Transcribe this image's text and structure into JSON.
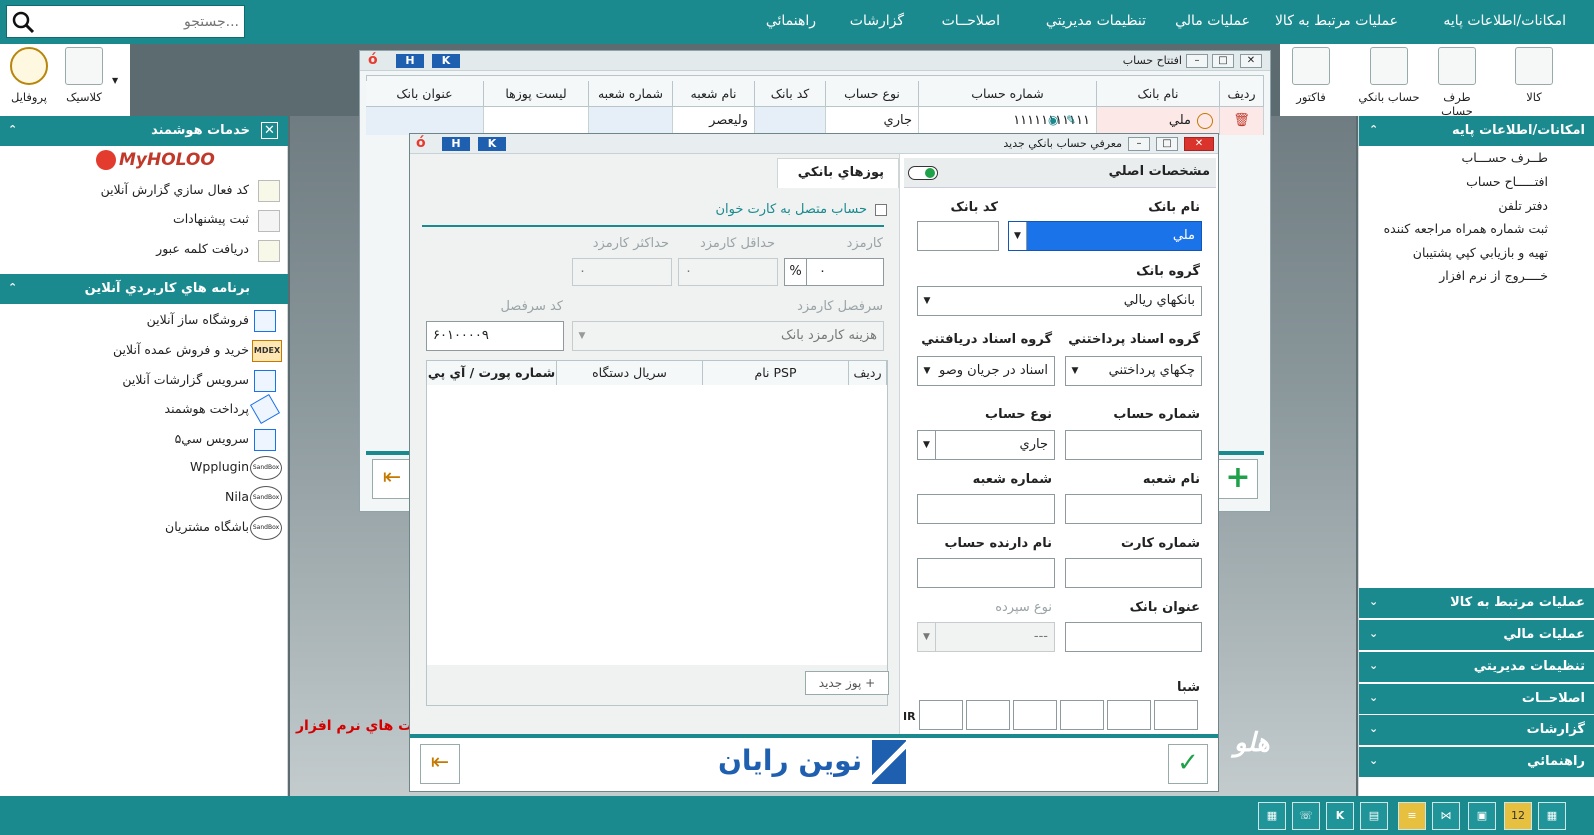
{
  "menubar": {
    "items": [
      "امکانات/اطلاعات پايه",
      "عمليات مرتبط به کالا",
      "عمليات مالي",
      "تنظيمات مديريتي",
      "اصلاحــات",
      "گزارشات",
      "راهنمائي"
    ],
    "search_placeholder": "جستجو..."
  },
  "toolbar_left": {
    "profile": "پروفايل",
    "classic": "کلاسيک"
  },
  "toolbar_right": {
    "items": [
      "کالا",
      "طرف حساب",
      "حساب بانکي",
      "فاکتور"
    ]
  },
  "smart_services": {
    "title": "خدمات هوشمند",
    "logo": "MyHOLOO",
    "items": [
      "کد فعال سازي گزارش آنلاين",
      "ثبت پيشنهادات",
      "دريافت کلمه عبور"
    ]
  },
  "online_apps": {
    "title": "برنامه هاي کاربردي آنلاين",
    "items": [
      "فروشگاه ساز آنلاين",
      "خريد و فروش عمده آنلاين",
      "سرويس گزارشات آنلاين",
      "پرداخت هوشمند",
      "سرويس سي۵",
      "Wpplugin",
      "Nila",
      "باشگاه مشتريان"
    ],
    "badge": "SandBox",
    "mdex": "MDEX"
  },
  "right_panel": {
    "title": "امکانات/اطلاعات پايه",
    "items": [
      "طــرف حســـاب",
      "افتـــــاح حساب",
      "دفتر تلفن",
      "ثبت شماره همراه مراجعه کننده",
      "تهيه و بازيابي کپي پشتيبان",
      "خــــروج از نرم افزار"
    ],
    "sections": [
      "عمليات مرتبط به کالا",
      "عمليات مالي",
      "تنظيمات مديريتي",
      "اصلاحــات",
      "گزارشات",
      "راهنمائي"
    ]
  },
  "desktop": {
    "slogan": "ت هاي نرم افزار",
    "logo": "هلو"
  },
  "account_window": {
    "title": "افتتاح حساب",
    "h": "H",
    "k": "K",
    "columns": [
      "رديف",
      "نام بانک",
      "شماره حساب",
      "نوع حساب",
      "کد بانک",
      "نام شعبه",
      "شماره شعبه",
      "ليست پوزها",
      "عنوان بانک"
    ],
    "row": {
      "bank": "ملي",
      "account": "۱۱۱۱۱۱۱۱۱۱۱",
      "type": "جاري",
      "code": "",
      "branch_name": "وليعصر",
      "branch_no": "",
      "pos_list": "",
      "title": ""
    }
  },
  "new_bank_dialog": {
    "title": "معرفي حساب بانکي جديد",
    "tab_main": "مشخصات اصلي",
    "tab_pos": "پوزهاي بانکي",
    "bank_name_label": "نام بانک",
    "bank_name": "ملي",
    "bank_code_label": "کد بانک",
    "bank_group_label": "گروه بانک",
    "bank_group": "بانکهاي ريالي",
    "pay_group_label": "گروه اسناد پرداختني",
    "pay_group": "چکهاي پرداختني",
    "recv_group_label": "گروه اسناد دريافتني",
    "recv_group": "اسناد در جريان وصو",
    "account_no_label": "شماره حساب",
    "account_type_label": "نوع حساب",
    "account_type": "جاري",
    "branch_name_label": "نام شعبه",
    "branch_no_label": "شماره شعبه",
    "card_no_label": "شماره کارت",
    "holder_label": "نام دارنده حساب",
    "bank_title_label": "عنوان بانک",
    "deposit_type_label": "نوع سپرده",
    "deposit_type": "---",
    "sheba_label": "شبا",
    "sheba_prefix": "IR",
    "card_reader_label": "حساب متصل به کارت خوان",
    "fee_label": "کارمزد",
    "fee_value": "۰",
    "percent": "%",
    "min_fee_label": "حداقل کارمزد",
    "min_fee": "۰",
    "max_fee_label": "حداکثر کارمزد",
    "max_fee": "۰",
    "fee_header_label": "سرفصل کارمزد",
    "fee_header": "هزينه کارمزد بانک",
    "header_code_label": "کد سرفصل",
    "header_code": "۶۰۱۰۰۰۰۹",
    "pos_columns": [
      "رديف",
      "نام PSP",
      "سريال دستگاه",
      "شماره پورت / آي پي"
    ],
    "new_pos": "پوز جديد",
    "brand": "نوين رايان"
  },
  "colors": {
    "teal": "#1a8a8f",
    "accent": "#1a73e8",
    "brand_blue": "#1f5fb0"
  }
}
